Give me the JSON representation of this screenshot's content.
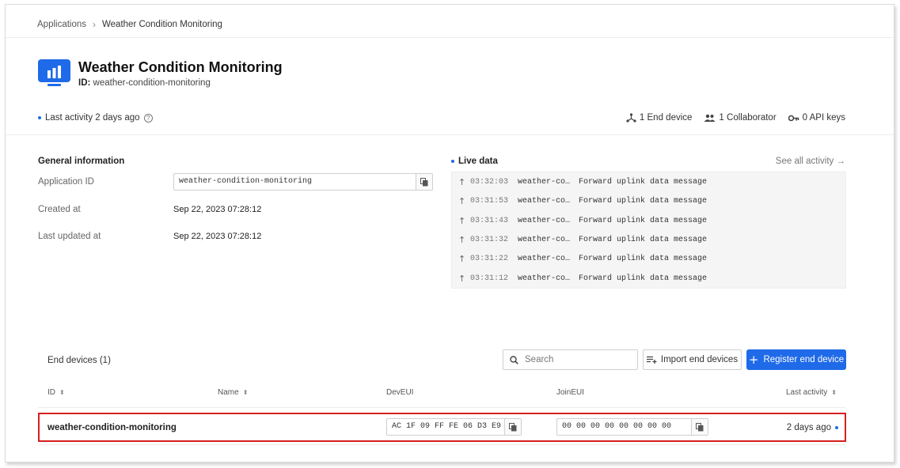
{
  "breadcrumb": {
    "root": "Applications",
    "current": "Weather Condition Monitoring"
  },
  "app": {
    "title": "Weather Condition Monitoring",
    "id_label": "ID:",
    "id_value": "weather-condition-monitoring"
  },
  "activity": {
    "text": "Last activity 2 days ago"
  },
  "stats": {
    "end_devices": "1 End device",
    "collaborators": "1 Collaborator",
    "api_keys": "0 API keys"
  },
  "general": {
    "title": "General information",
    "app_id_label": "Application ID",
    "app_id_value": "weather-condition-monitoring",
    "created_label": "Created at",
    "created_value": "Sep 22, 2023 07:28:12",
    "updated_label": "Last updated at",
    "updated_value": "Sep 22, 2023 07:28:12"
  },
  "live": {
    "title": "Live data",
    "see_all": "See all activity →",
    "rows": [
      {
        "time": "03:32:03",
        "device": "weather-co…",
        "message": "Forward uplink data message"
      },
      {
        "time": "03:31:53",
        "device": "weather-co…",
        "message": "Forward uplink data message"
      },
      {
        "time": "03:31:43",
        "device": "weather-co…",
        "message": "Forward uplink data message"
      },
      {
        "time": "03:31:32",
        "device": "weather-co…",
        "message": "Forward uplink data message"
      },
      {
        "time": "03:31:22",
        "device": "weather-co…",
        "message": "Forward uplink data message"
      },
      {
        "time": "03:31:12",
        "device": "weather-co…",
        "message": "Forward uplink data message"
      }
    ]
  },
  "end_devices": {
    "title": "End devices (1)",
    "search_placeholder": "Search",
    "import_label": "Import end devices",
    "register_label": "Register end device",
    "columns": {
      "id": "ID",
      "name": "Name",
      "deveui": "DevEUI",
      "joineui": "JoinEUI",
      "last_activity": "Last activity"
    },
    "rows": [
      {
        "id": "weather-condition-monitoring",
        "name": "",
        "deveui": "AC 1F 09 FF FE 06 D3 E9",
        "joineui": "00 00 00 00 00 00 00 00",
        "last_activity": "2 days ago"
      }
    ]
  },
  "colors": {
    "accent": "#1f6ae8",
    "highlight": "#d61f1f"
  }
}
